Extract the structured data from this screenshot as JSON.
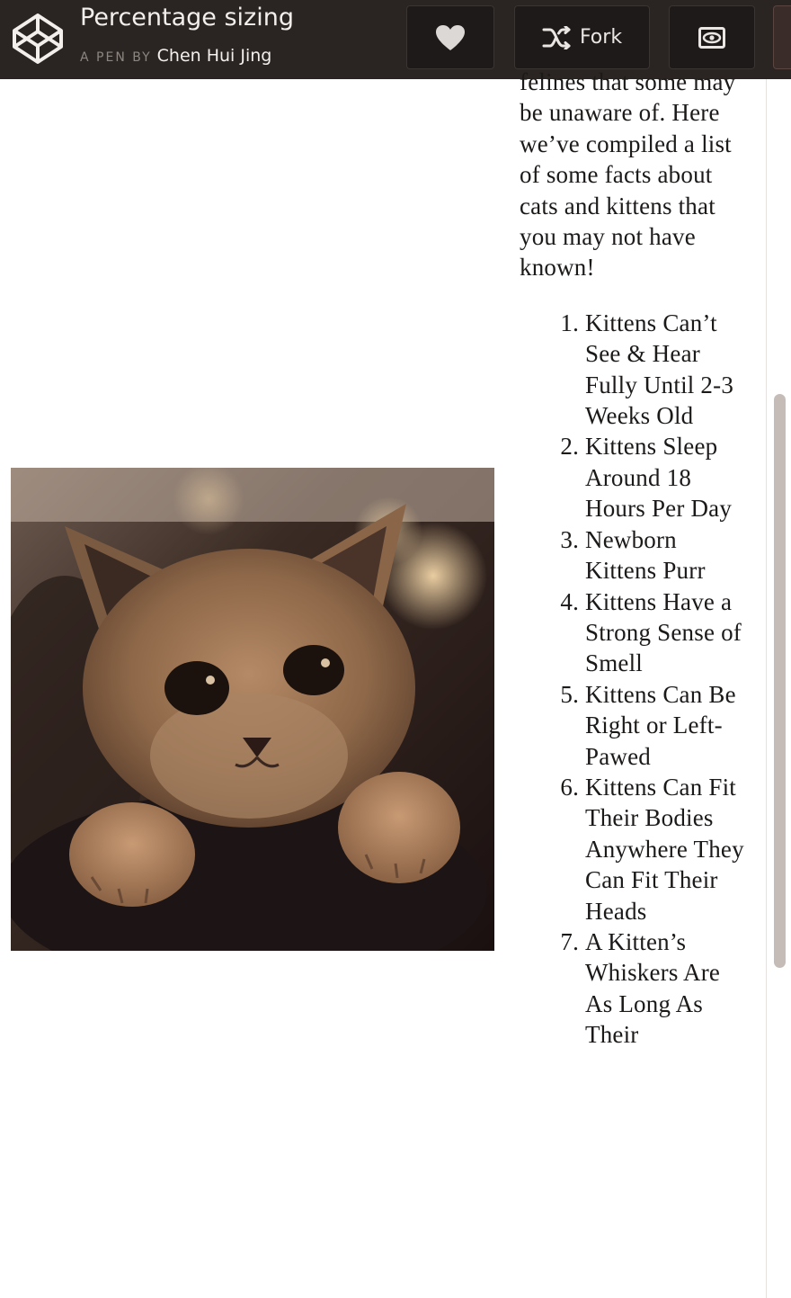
{
  "header": {
    "pen_title": "Percentage sizing",
    "byline_prefix": "A PEN BY",
    "author": "Chen Hui Jing",
    "fork_label": "Fork",
    "icons": [
      "codepen-logo-icon",
      "heart-icon",
      "fork-icon",
      "eye-icon"
    ]
  },
  "image": {
    "alt": "kitten"
  },
  "article": {
    "intro": "felines that some may be unaware of. Here we’ve compiled a list of some facts about cats and kittens that you may not have known!",
    "facts": [
      "Kittens Can’t See & Hear Fully Until 2-3 Weeks Old",
      "Kittens Sleep Around 18 Hours Per Day",
      "Newborn Kittens Purr",
      "Kittens Have a Strong Sense of Smell",
      "Kittens Can Be Right or Left-Pawed",
      "Kittens Can Fit Their Bodies Anywhere They Can Fit Their Heads",
      "A Kitten’s Whiskers Are As Long As Their"
    ]
  },
  "colors": {
    "header_bg": "#2a2523",
    "header_text": "#f2efec",
    "button_bg": "#1e1a19",
    "scroll_thumb": "#c5bcb8"
  }
}
